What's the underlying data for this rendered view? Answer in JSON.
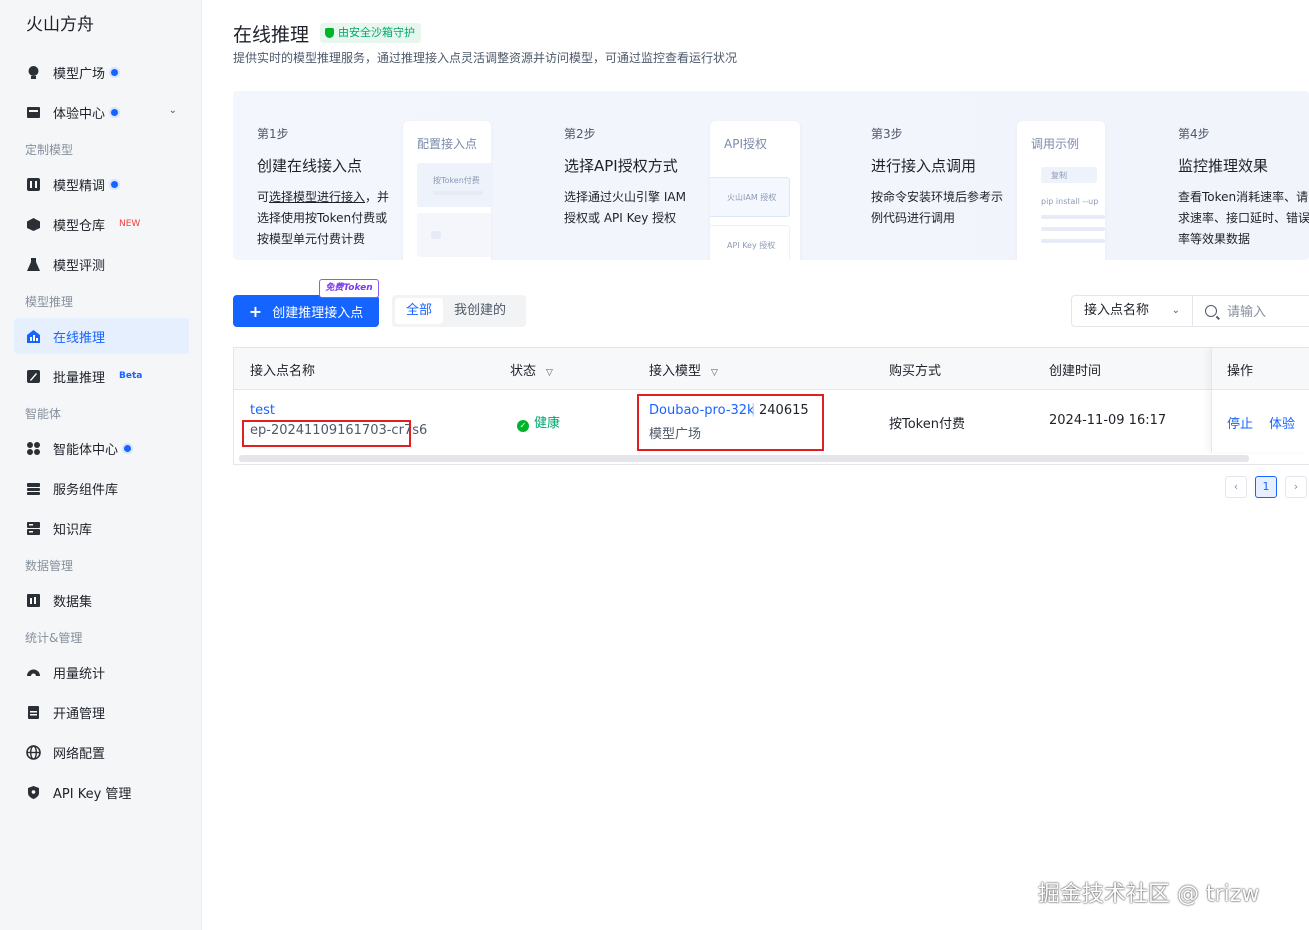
{
  "sidebar": {
    "brand": "火山方舟",
    "items": [
      {
        "label": "模型广场",
        "icon": "lightbulb-icon",
        "dot": true
      },
      {
        "label": "体验中心",
        "icon": "inbox-icon",
        "dot": true
      },
      {
        "label": "模型精调",
        "icon": "tune-icon",
        "dot": true
      },
      {
        "label": "模型仓库",
        "icon": "cube-icon",
        "tag": "NEW"
      },
      {
        "label": "模型评测",
        "icon": "flask-icon"
      },
      {
        "label": "在线推理",
        "icon": "bar-chart-icon",
        "active": true
      },
      {
        "label": "批量推理",
        "icon": "rocket-icon",
        "tag": "Beta"
      },
      {
        "label": "智能体中心",
        "icon": "grid-icon",
        "dot": true
      },
      {
        "label": "服务组件库",
        "icon": "stack-icon"
      },
      {
        "label": "知识库",
        "icon": "server-icon"
      },
      {
        "label": "数据集",
        "icon": "dataset-icon"
      },
      {
        "label": "用量统计",
        "icon": "gauge-icon"
      },
      {
        "label": "开通管理",
        "icon": "clipboard-icon"
      },
      {
        "label": "网络配置",
        "icon": "globe-icon"
      },
      {
        "label": "API Key 管理",
        "icon": "shield-key-icon"
      }
    ],
    "sections": [
      "定制模型",
      "模型推理",
      "智能体",
      "数据管理",
      "统计&管理"
    ]
  },
  "header": {
    "title": "在线推理",
    "badge": "由安全沙箱守护",
    "description": "提供实时的模型推理服务，通过推理接入点灵活调整资源并访问模型，可通过监控查看运行状况"
  },
  "steps": [
    {
      "num": "第1步",
      "title": "创建在线接入点",
      "pre": "可",
      "link": "选择模型进行接入",
      "text": "，并选择使用按Token付费或按模型单元付费计费",
      "mock_title": "配置接入点",
      "mock_label": "按Token付费"
    },
    {
      "num": "第2步",
      "title": "选择API授权方式",
      "text": "选择通过火山引擎 IAM 授权或 API Key 授权",
      "mock_title": "API授权",
      "mock_label": "火山IAM 授权",
      "mock_label2": "API Key 授权"
    },
    {
      "num": "第3步",
      "title": "进行接入点调用",
      "text": "按命令安装环境后参考示例代码进行调用",
      "mock_title": "调用示例",
      "mock_label": "复制",
      "mock_label2": "pip install --up"
    },
    {
      "num": "第4步",
      "title": "监控推理效果",
      "text": "查看Token消耗速率、请求速率、接口延时、错误率等效果数据"
    }
  ],
  "toolbar": {
    "create_label": "创建推理接入点",
    "free_badge": "免费Token",
    "tabs": [
      "全部",
      "我创建的"
    ],
    "filter_label": "接入点名称",
    "search_placeholder": "请输入"
  },
  "table": {
    "columns": [
      "接入点名称",
      "状态",
      "接入模型",
      "购买方式",
      "创建时间",
      "操作"
    ],
    "rows": [
      {
        "name": "test",
        "id": "ep-20241109161703-cr7s6",
        "status": "健康",
        "model": "Doubao-pro-32k",
        "version": "240615",
        "source": "模型广场",
        "billing": "按Token付费",
        "created": "2024-11-09 16:17",
        "actions": [
          "停止",
          "体验"
        ]
      }
    ]
  },
  "pagination": {
    "prev": "‹",
    "current": "1",
    "next": "›"
  },
  "watermark": "掘金技术社区 @ trizw",
  "colors": {
    "accent": "#1664ff",
    "success": "#00b42a",
    "highlight": "#e02020"
  }
}
